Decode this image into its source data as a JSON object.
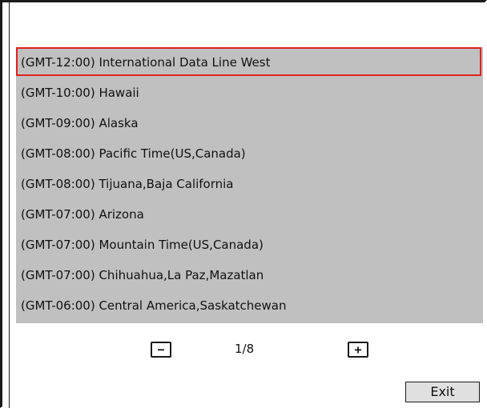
{
  "timezones": {
    "items": [
      {
        "label": "(GMT-12:00) International Data Line West",
        "selected": true
      },
      {
        "label": "(GMT-10:00) Hawaii",
        "selected": false
      },
      {
        "label": "(GMT-09:00) Alaska",
        "selected": false
      },
      {
        "label": "(GMT-08:00) Pacific Time(US,Canada)",
        "selected": false
      },
      {
        "label": "(GMT-08:00) Tijuana,Baja California",
        "selected": false
      },
      {
        "label": "(GMT-07:00) Arizona",
        "selected": false
      },
      {
        "label": "(GMT-07:00) Mountain Time(US,Canada)",
        "selected": false
      },
      {
        "label": "(GMT-07:00) Chihuahua,La Paz,Mazatlan",
        "selected": false
      },
      {
        "label": "(GMT-06:00) Central America,Saskatchewan",
        "selected": false
      }
    ]
  },
  "pager": {
    "prev_label": "−",
    "next_label": "+",
    "page_text": "1/8"
  },
  "footer": {
    "exit_label": "Exit"
  },
  "colors": {
    "list_background": "#c0c0c0",
    "selection_border": "#e02020",
    "button_background": "#e0e0e0"
  }
}
